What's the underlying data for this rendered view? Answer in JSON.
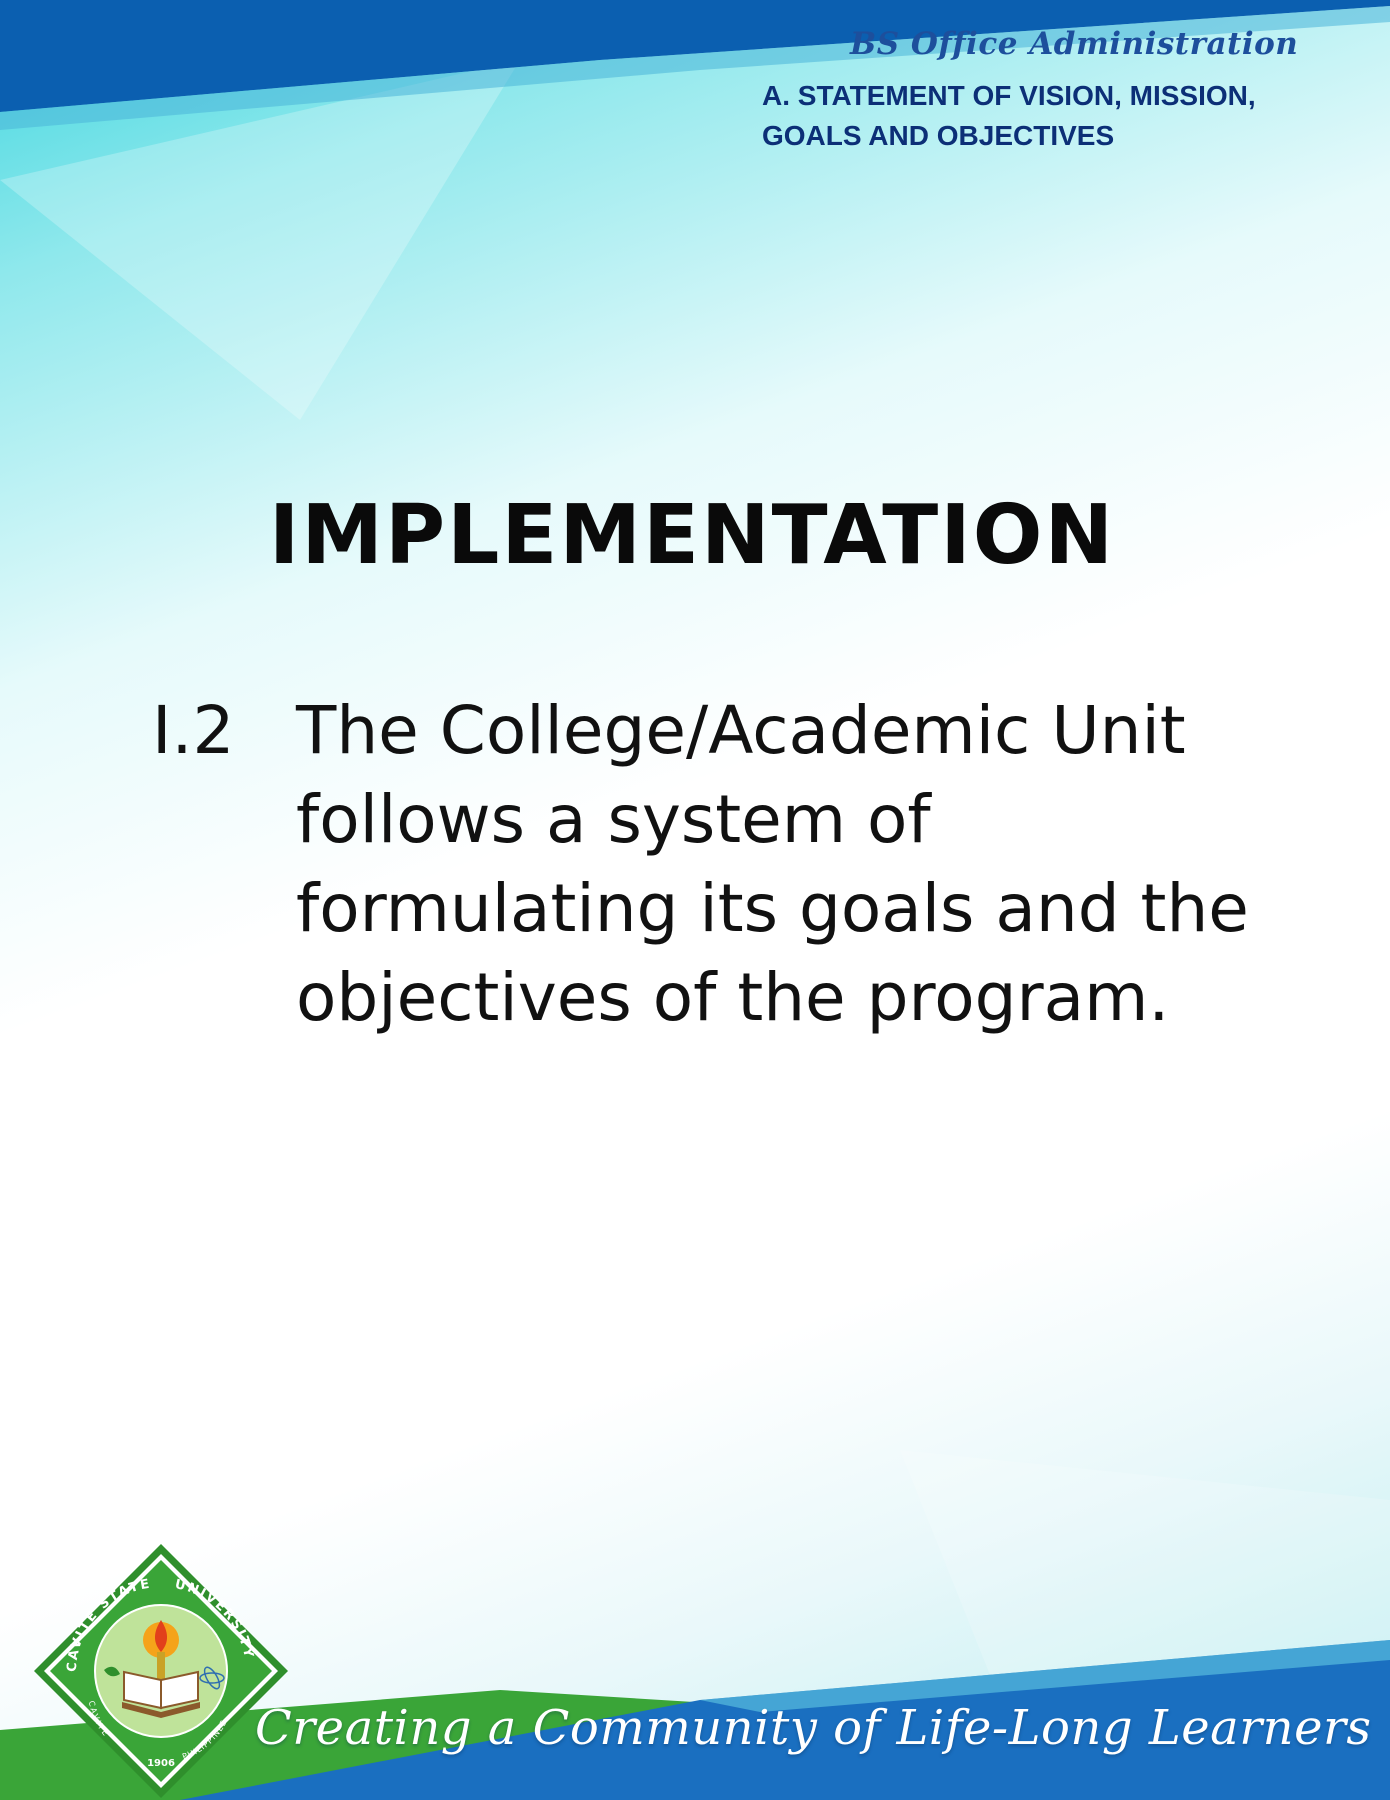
{
  "header": {
    "program": "BS Office Administration",
    "section_heading": "A.   STATEMENT OF VISION, MISSION, GOALS AND OBJECTIVES"
  },
  "main": {
    "title": "IMPLEMENTATION",
    "item": {
      "number": "I.2",
      "lines": [
        "The College/Academic Unit",
        "follows a system of",
        "formulating its goals and the",
        "objectives of the program."
      ]
    }
  },
  "logo": {
    "text_top_left": "CAVITE STATE",
    "text_top_right": "UNIVERSITY",
    "text_bottom_left": "CAVITE",
    "text_bottom_right": "PHILIPPINES",
    "year": "1906"
  },
  "footer": {
    "tagline": "Creating a Community of Life-Long Learners"
  },
  "colors": {
    "top_band": "#0b5fb0",
    "bottom_green": "#3aa538",
    "bottom_blue": "#1a6fc0",
    "heading_text": "#0c2f77"
  }
}
